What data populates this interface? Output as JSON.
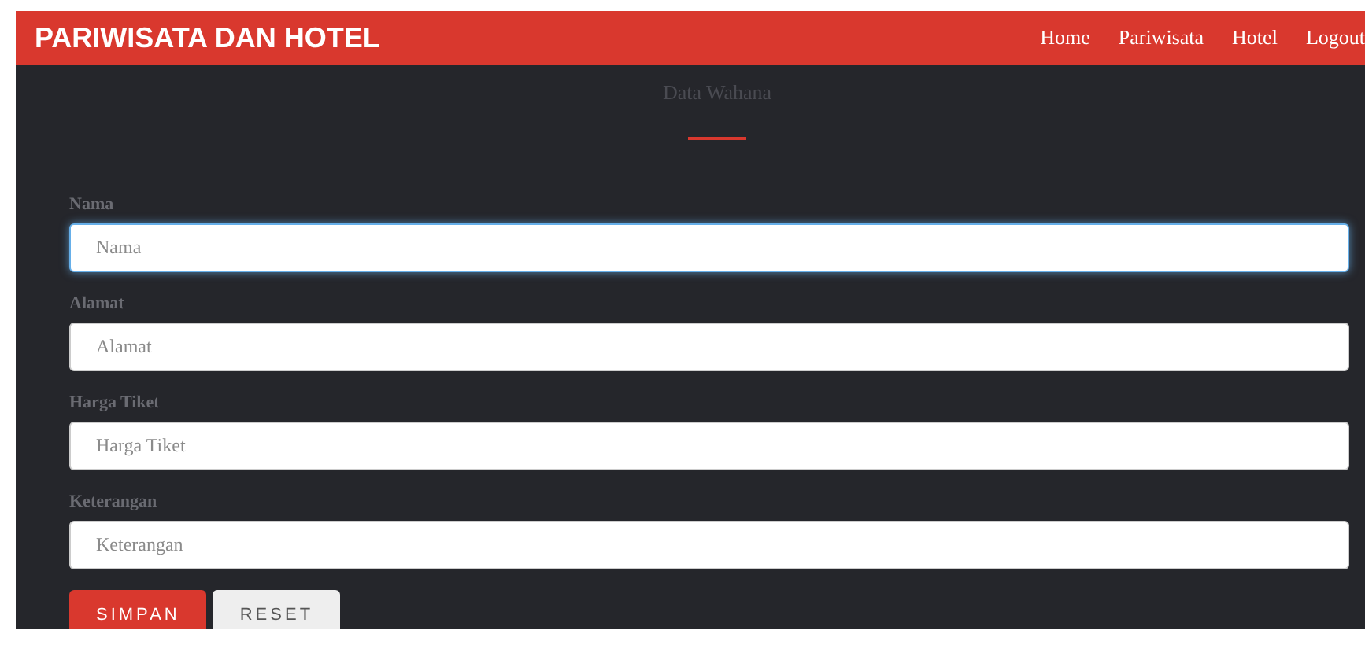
{
  "brand": "PARIWISATA DAN HOTEL",
  "nav": [
    {
      "label": "Home"
    },
    {
      "label": "Pariwisata"
    },
    {
      "label": "Hotel"
    },
    {
      "label": "Logout"
    }
  ],
  "heading": "Data Wahana",
  "fields": [
    {
      "label": "Nama",
      "placeholder": "Nama",
      "focused": true
    },
    {
      "label": "Alamat",
      "placeholder": "Alamat",
      "focused": false
    },
    {
      "label": "Harga Tiket",
      "placeholder": "Harga Tiket",
      "focused": false
    },
    {
      "label": "Keterangan",
      "placeholder": "Keterangan",
      "focused": false
    }
  ],
  "buttons": [
    {
      "label": "SIMPAN",
      "kind": "primary"
    },
    {
      "label": "RESET",
      "kind": "secondary"
    }
  ]
}
